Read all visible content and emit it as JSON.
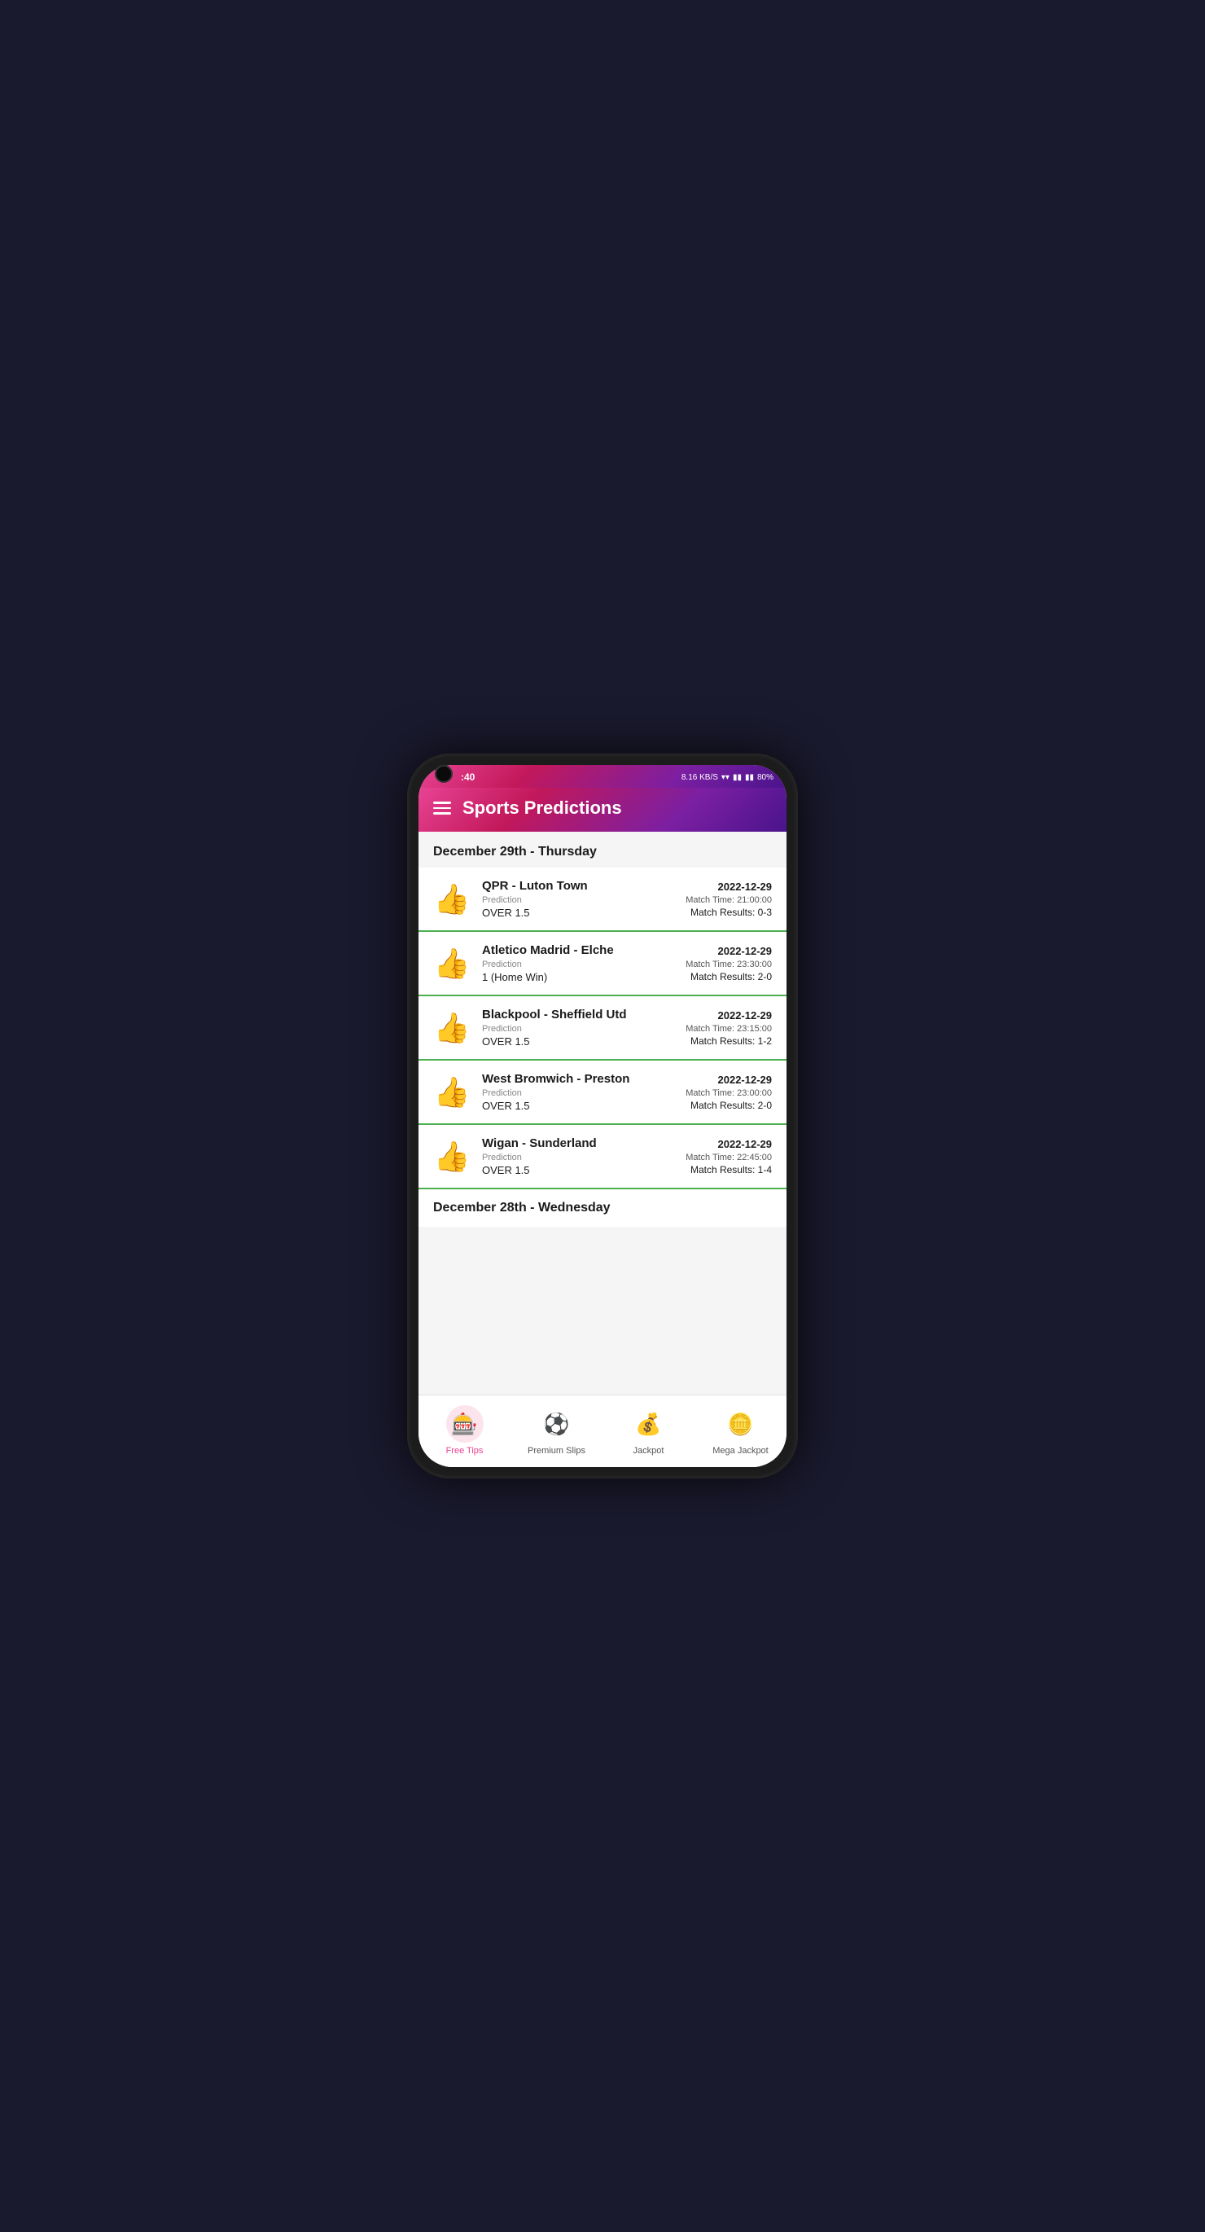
{
  "statusBar": {
    "time": ":40",
    "dataSpeed": "8.16 KB/S",
    "battery": "80%"
  },
  "header": {
    "title": "Sports Predictions"
  },
  "sections": [
    {
      "id": "section-dec29",
      "dateLabel": "December 29th - Thursday",
      "matches": [
        {
          "id": "match-1",
          "name": "QPR - Luton Town",
          "predictionLabel": "Prediction",
          "predictionValue": "OVER 1.5",
          "date": "2022-12-29",
          "matchTimeLabel": "Match Time:",
          "matchTime": "21:00:00",
          "matchResultLabel": "Match Results:",
          "matchResult": "0-3"
        },
        {
          "id": "match-2",
          "name": "Atletico Madrid - Elche",
          "predictionLabel": "Prediction",
          "predictionValue": "1 (Home Win)",
          "date": "2022-12-29",
          "matchTimeLabel": "Match Time:",
          "matchTime": "23:30:00",
          "matchResultLabel": "Match Results:",
          "matchResult": "2-0"
        },
        {
          "id": "match-3",
          "name": "Blackpool - Sheffield Utd",
          "predictionLabel": "Prediction",
          "predictionValue": "OVER 1.5",
          "date": "2022-12-29",
          "matchTimeLabel": "Match Time:",
          "matchTime": "23:15:00",
          "matchResultLabel": "Match Results:",
          "matchResult": "1-2"
        },
        {
          "id": "match-4",
          "name": "West Bromwich - Preston",
          "predictionLabel": "Prediction",
          "predictionValue": "OVER 1.5",
          "date": "2022-12-29",
          "matchTimeLabel": "Match Time:",
          "matchTime": "23:00:00",
          "matchResultLabel": "Match Results:",
          "matchResult": "2-0"
        },
        {
          "id": "match-5",
          "name": "Wigan - Sunderland",
          "predictionLabel": "Prediction",
          "predictionValue": "OVER 1.5",
          "date": "2022-12-29",
          "matchTimeLabel": "Match Time:",
          "matchTime": "22:45:00",
          "matchResultLabel": "Match Results:",
          "matchResult": "1-4"
        }
      ]
    }
  ],
  "partialSection": {
    "dateLabel": "December 28th - Wednesday"
  },
  "bottomNav": {
    "items": [
      {
        "id": "nav-free-tips",
        "label": "Free Tips",
        "icon": "🎰",
        "active": true
      },
      {
        "id": "nav-premium-slips",
        "label": "Premium Slips",
        "icon": "⚽",
        "active": false
      },
      {
        "id": "nav-jackpot",
        "label": "Jackpot",
        "icon": "💰",
        "active": false
      },
      {
        "id": "nav-mega-jackpot",
        "label": "Mega Jackpot",
        "icon": "🪙",
        "active": false
      }
    ]
  }
}
